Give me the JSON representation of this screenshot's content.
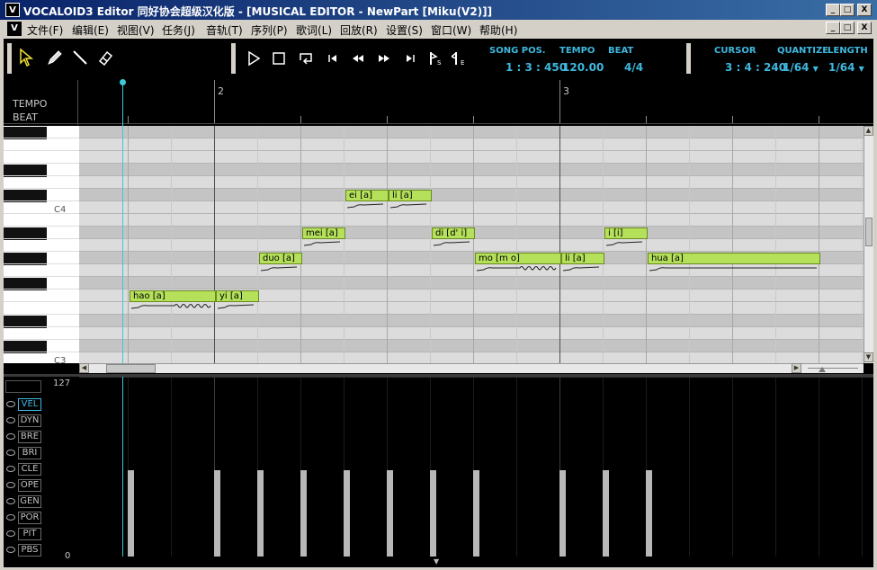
{
  "window": {
    "app_icon": "V",
    "title": "VOCALOID3 Editor 同好协会超级汉化版 - [MUSICAL EDITOR - NewPart [Miku(V2)]]",
    "min": "_",
    "max": "□",
    "close": "X"
  },
  "menu": {
    "icon": "V",
    "items": [
      "文件(F)",
      "编辑(E)",
      "视图(V)",
      "任务(J)",
      "音轨(T)",
      "序列(P)",
      "歌词(L)",
      "回放(R)",
      "设置(S)",
      "窗口(W)",
      "帮助(H)"
    ]
  },
  "toolbar": {
    "tools": [
      "arrow-tool-icon",
      "pencil-tool-icon",
      "line-tool-icon",
      "eraser-tool-icon"
    ],
    "transport": [
      "play-icon",
      "stop-icon",
      "loop-icon",
      "go-start-icon",
      "rewind-icon",
      "fast-forward-icon",
      "go-end-icon",
      "start-marker-icon",
      "end-marker-icon"
    ]
  },
  "info": {
    "song_pos_label": "SONG POS.",
    "song_pos": "1 : 3 : 450",
    "tempo_label": "TEMPO",
    "tempo": "120.00",
    "beat_label": "BEAT",
    "beat": "4/4",
    "cursor_label": "CURSOR",
    "cursor": "3 : 4 : 240",
    "quantize_label": "QUANTIZE",
    "quantize": "1/64",
    "length_label": "LENGTH",
    "length": "1/64",
    "accent_color": "#3fb8e0"
  },
  "ruler": {
    "tempo_label": "TEMPO",
    "beat_label": "BEAT",
    "measures": [
      "2",
      "3"
    ]
  },
  "piano": {
    "labels": [
      "C4",
      "C3"
    ]
  },
  "notes": [
    {
      "lyric": "hao [a]",
      "vibrato": true
    },
    {
      "lyric": "yi [a]",
      "vibrato": false
    },
    {
      "lyric": "duo [a]",
      "vibrato": false
    },
    {
      "lyric": "mei [a]",
      "vibrato": false
    },
    {
      "lyric": "ei [a]",
      "vibrato": false
    },
    {
      "lyric": "li [a]",
      "vibrato": false
    },
    {
      "lyric": "di [d' i]",
      "vibrato": false
    },
    {
      "lyric": "mo [m o]",
      "vibrato": true
    },
    {
      "lyric": "li [a]",
      "vibrato": false
    },
    {
      "lyric": "i [i]",
      "vibrato": false
    },
    {
      "lyric": "hua [a]",
      "vibrato": false
    }
  ],
  "control": {
    "max": "127",
    "min": "0",
    "tabs": [
      "VEL",
      "DYN",
      "BRE",
      "BRI",
      "CLE",
      "OPE",
      "GEN",
      "POR",
      "PIT",
      "PBS"
    ],
    "active_tab": "VEL"
  },
  "colors": {
    "note_fill": "#b4e05a",
    "playhead": "#3fc8d8"
  }
}
